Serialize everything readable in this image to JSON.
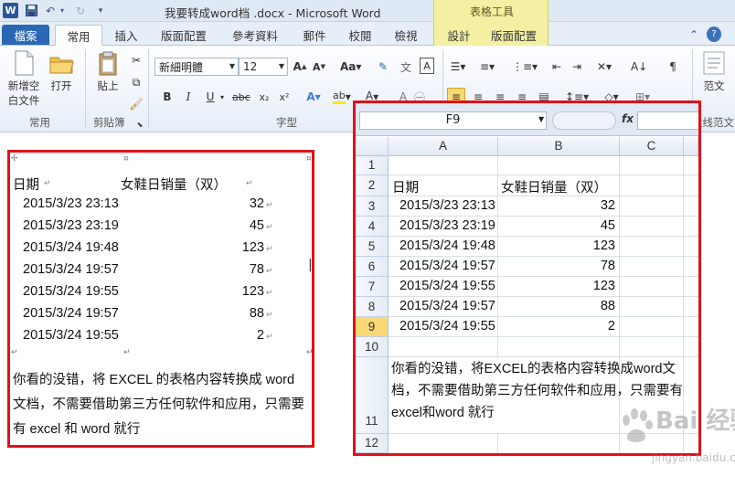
{
  "window": {
    "title": "我要转成word档 .docx - Microsoft Word",
    "context_group": "表格工具"
  },
  "tabs": [
    "檔案",
    "常用",
    "插入",
    "版面配置",
    "參考資料",
    "郵件",
    "校閱",
    "檢視",
    "設計",
    "版面配置"
  ],
  "ribbon": {
    "new_blank_line1": "新增空",
    "new_blank_line2": "白文件",
    "open": "打开",
    "common_group": "常用",
    "paste": "貼上",
    "clipboard_group": "剪貼簿",
    "font_name": "新細明體",
    "font_size": "12",
    "font_group": "字型",
    "style_label": "范文",
    "right_group_partial": "段线范文"
  },
  "word_table": {
    "header": {
      "date": "日期",
      "sales": "女鞋日销量（双）"
    },
    "rows": [
      {
        "date": "2015/3/23 23:13",
        "value": "32"
      },
      {
        "date": "2015/3/23 23:19",
        "value": "45"
      },
      {
        "date": "2015/3/24 19:48",
        "value": "123"
      },
      {
        "date": "2015/3/24 19:57",
        "value": "78"
      },
      {
        "date": "2015/3/24 19:55",
        "value": "123"
      },
      {
        "date": "2015/3/24 19:57",
        "value": "88"
      },
      {
        "date": "2015/3/24 19:55",
        "value": "2"
      }
    ],
    "note": "你看的没错，将 EXCEL 的表格内容转换成 word 文档，不需要借助第三方任何软件和应用，只需要有 excel 和 word 就行"
  },
  "excel": {
    "name_box": "F9",
    "fx": "fx",
    "columns": [
      "A",
      "B",
      "C"
    ],
    "row_numbers": [
      "1",
      "2",
      "3",
      "4",
      "5",
      "6",
      "7",
      "8",
      "9",
      "10",
      "11",
      "12"
    ],
    "selected_row": "9",
    "header": {
      "date": "日期",
      "sales": "女鞋日销量（双）"
    },
    "rows": [
      {
        "date": "2015/3/23 23:13",
        "value": "32"
      },
      {
        "date": "2015/3/23 23:19",
        "value": "45"
      },
      {
        "date": "2015/3/24 19:48",
        "value": "123"
      },
      {
        "date": "2015/3/24 19:57",
        "value": "78"
      },
      {
        "date": "2015/3/24 19:55",
        "value": "123"
      },
      {
        "date": "2015/3/24 19:57",
        "value": "88"
      },
      {
        "date": "2015/3/24 19:55",
        "value": "2"
      }
    ],
    "note": "你看的没错，将EXCEL的表格内容转换成word文档，不需要借助第三方任何软件和应用，只需要有excel和word 就行"
  },
  "watermark": {
    "line1": "Bai 经验",
    "line2": "jingyan.baidu.com"
  },
  "colors": {
    "highlight_frame": "#e0121a",
    "file_tab": "#2a67b4",
    "context_tab": "#f3f0a4",
    "selected_row_header": "#f8d975"
  }
}
